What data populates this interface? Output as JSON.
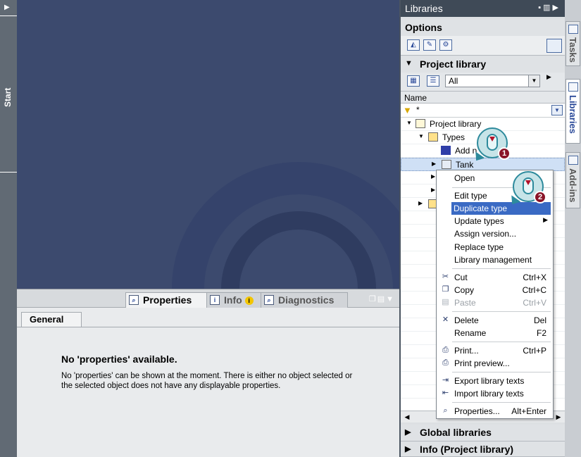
{
  "start_strip": {
    "label": "Start"
  },
  "properties_pane": {
    "tabs": [
      {
        "label": "Properties"
      },
      {
        "label": "Info"
      },
      {
        "label": "Diagnostics"
      }
    ],
    "info_badge": "i",
    "general_tab": "General",
    "no_props_title": "No 'properties' available.",
    "no_props_text": "No 'properties' can be shown at the moment. There is either no object selected or the selected object does not have any displayable properties."
  },
  "libraries": {
    "title": "Libraries",
    "options_label": "Options",
    "project_library_label": "Project library",
    "filter_combo_value": "All",
    "name_column": "Name",
    "filter_text": "*",
    "tree": [
      {
        "label": "Project library"
      },
      {
        "label": "Types"
      },
      {
        "label": "Add n"
      },
      {
        "label": "Tank"
      }
    ],
    "global_libraries_label": "Global libraries",
    "info_label": "Info (Project library)"
  },
  "side_tabs": [
    {
      "label": "Tasks"
    },
    {
      "label": "Libraries"
    },
    {
      "label": "Add-ins"
    }
  ],
  "context_menu": {
    "items": [
      {
        "label": "Open",
        "shortcut": ""
      },
      {
        "label": "Edit type",
        "shortcut": ""
      },
      {
        "label": "Duplicate type",
        "shortcut": ""
      },
      {
        "label": "Update types",
        "shortcut": ""
      },
      {
        "label": "Assign version...",
        "shortcut": ""
      },
      {
        "label": "Replace type",
        "shortcut": ""
      },
      {
        "label": "Library management",
        "shortcut": ""
      },
      {
        "label": "Cut",
        "shortcut": "Ctrl+X"
      },
      {
        "label": "Copy",
        "shortcut": "Ctrl+C"
      },
      {
        "label": "Paste",
        "shortcut": "Ctrl+V"
      },
      {
        "label": "Delete",
        "shortcut": "Del"
      },
      {
        "label": "Rename",
        "shortcut": "F2"
      },
      {
        "label": "Print...",
        "shortcut": "Ctrl+P"
      },
      {
        "label": "Print preview...",
        "shortcut": ""
      },
      {
        "label": "Export library texts",
        "shortcut": ""
      },
      {
        "label": "Import library texts",
        "shortcut": ""
      },
      {
        "label": "Properties...",
        "shortcut": "Alt+Enter"
      }
    ]
  },
  "callouts": [
    {
      "number": "1"
    },
    {
      "number": "2"
    }
  ],
  "colors": {
    "highlight": "#3a6ac4",
    "workspace": "#3c4a6e",
    "callout_badge": "#8a1428"
  }
}
